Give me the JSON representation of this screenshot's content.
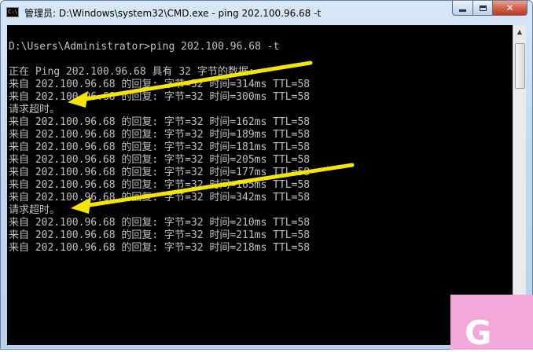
{
  "window": {
    "title": "管理员: D:\\Windows\\system32\\CMD.exe - ping  202.100.96.68 -t",
    "icon_text": "C:\\",
    "buttons": {
      "minimize": "minimize-icon",
      "maximize": "maximize-icon",
      "close": "✕"
    }
  },
  "console": {
    "lines": [
      "D:\\Users\\Administrator>ping 202.100.96.68 -t",
      "",
      "正在 Ping 202.100.96.68 具有 32 字节的数据:",
      "来自 202.100.96.68 的回复: 字节=32 时间=314ms TTL=58",
      "来自 202.100.96.68 的回复: 字节=32 时间=300ms TTL=58",
      "请求超时。",
      "来自 202.100.96.68 的回复: 字节=32 时间=162ms TTL=58",
      "来自 202.100.96.68 的回复: 字节=32 时间=189ms TTL=58",
      "来自 202.100.96.68 的回复: 字节=32 时间=181ms TTL=58",
      "来自 202.100.96.68 的回复: 字节=32 时间=205ms TTL=58",
      "来自 202.100.96.68 的回复: 字节=32 时间=177ms TTL=58",
      "来自 202.100.96.68 的回复: 字节=32 时间=165ms TTL=58",
      "来自 202.100.96.68 的回复: 字节=32 时间=342ms TTL=58",
      "请求超时。",
      "来自 202.100.96.68 的回复: 字节=32 时间=210ms TTL=58",
      "来自 202.100.96.68 的回复: 字节=32 时间=211ms TTL=58",
      "来自 202.100.96.68 的回复: 字节=32 时间=218ms TTL=58"
    ]
  },
  "colors": {
    "console_bg": "#000000",
    "console_text": "#c0c0c0",
    "annotation_arrow": "#f5e600",
    "watermark_bg": "#f2a9d9"
  },
  "annotations": {
    "arrow_icon": "yellow-arrow-icon",
    "watermark_icon": "watermark-logo-icon"
  }
}
